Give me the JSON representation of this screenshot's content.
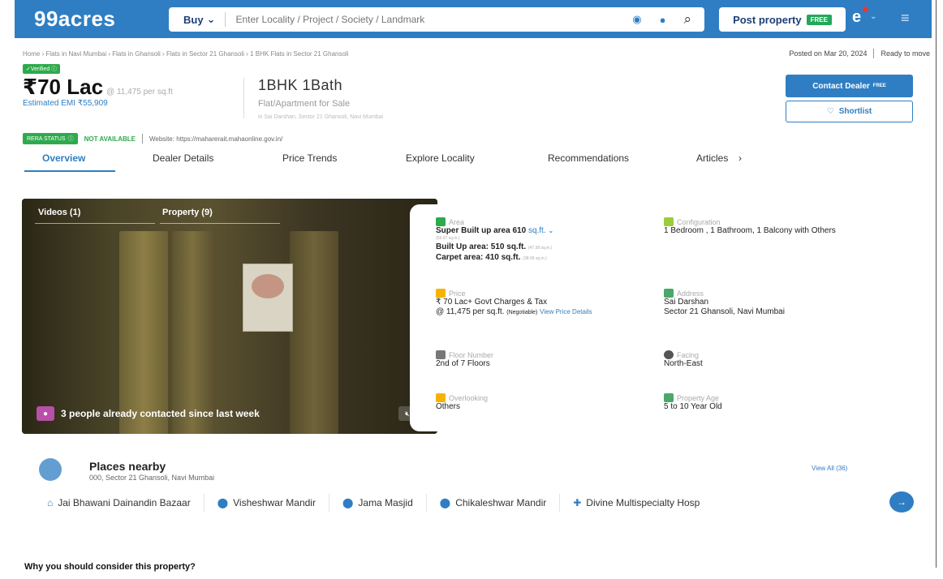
{
  "header": {
    "logo": "99acres",
    "buy_label": "Buy",
    "search_placeholder": "Enter Locality / Project / Society / Landmark",
    "post_property": "Post property",
    "free": "FREE"
  },
  "breadcrumb": "Home › Flats in Navi Mumbai › Flats in Ghansoli › Flats in Sector 21 Ghansoli › 1 BHK Flats in Sector 21 Ghansoli",
  "posted": {
    "date": "Posted on Mar 20, 2024",
    "status": "Ready to move"
  },
  "summary": {
    "verified": "✓Verified ⓘ",
    "price": "₹70 Lac",
    "price_per_sqft": "@ 11,475 per sq.ft",
    "emi": "Estimated EMI ₹55,909",
    "bhk": "1BHK 1Bath",
    "type": "Flat/Apartment for Sale",
    "location": "in Sai Darshan, Sector 21 Ghansoli, Navi Mumbai"
  },
  "actions": {
    "contact": "Contact Dealer",
    "contact_free": "FREE",
    "shortlist": "Shortlist"
  },
  "rera": {
    "badge": "RERA STATUS",
    "status": "NOT AVAILABLE",
    "website": "Website: https://maharerait.mahaonline.gov.in/"
  },
  "tabs": [
    {
      "label": "Overview"
    },
    {
      "label": "Dealer Details"
    },
    {
      "label": "Price Trends"
    },
    {
      "label": "Explore Locality"
    },
    {
      "label": "Recommendations"
    },
    {
      "label": "Articles"
    }
  ],
  "media": {
    "videos": "Videos (1)",
    "property": "Property (9)",
    "contacted": "3 people already contacted since last week"
  },
  "details": {
    "area": {
      "label": "Area",
      "super": "Super Built up area 610",
      "unit": "sq.ft.",
      "super_sqm": "(56.67 sq.m.)",
      "built": "Built Up area: 510 sq.ft.",
      "built_sqm": "(47.38 sq.m.)",
      "carpet": "Carpet area: 410 sq.ft.",
      "carpet_sqm": "(38.09 sq.m.)"
    },
    "config": {
      "label": "Configuration",
      "value": "1 Bedroom , 1 Bathroom, 1 Balcony with Others"
    },
    "price": {
      "label": "Price",
      "line1": "₹ 70 Lac+ Govt Charges & Tax",
      "line2": "@ 11,475 per sq.ft.",
      "negotiable": "(Negotiable)",
      "link": "View Price Details"
    },
    "address": {
      "label": "Address",
      "line1": "Sai Darshan",
      "line2": "Sector 21 Ghansoli, Navi Mumbai"
    },
    "floor": {
      "label": "Floor Number",
      "value": "2nd of 7 Floors"
    },
    "facing": {
      "label": "Facing",
      "value": "North-East"
    },
    "overlooking": {
      "label": "Overlooking",
      "value": "Others"
    },
    "age": {
      "label": "Property Age",
      "value": "5 to 10 Year Old"
    }
  },
  "places": {
    "title": "Places nearby",
    "sub": "000, Sector 21 Ghansoli, Navi Mumbai",
    "view_all": "View All (36)",
    "items": [
      {
        "name": "Jai Bhawani Dainandin Bazaar"
      },
      {
        "name": "Visheshwar Mandir"
      },
      {
        "name": "Jama Masjid"
      },
      {
        "name": "Chikaleshwar Mandir"
      },
      {
        "name": "Divine Multispecialty Hosp"
      }
    ]
  },
  "why": "Why you should consider this property?",
  "colors": {
    "brand": "#2f7ec3",
    "green": "#2eaa4c"
  }
}
